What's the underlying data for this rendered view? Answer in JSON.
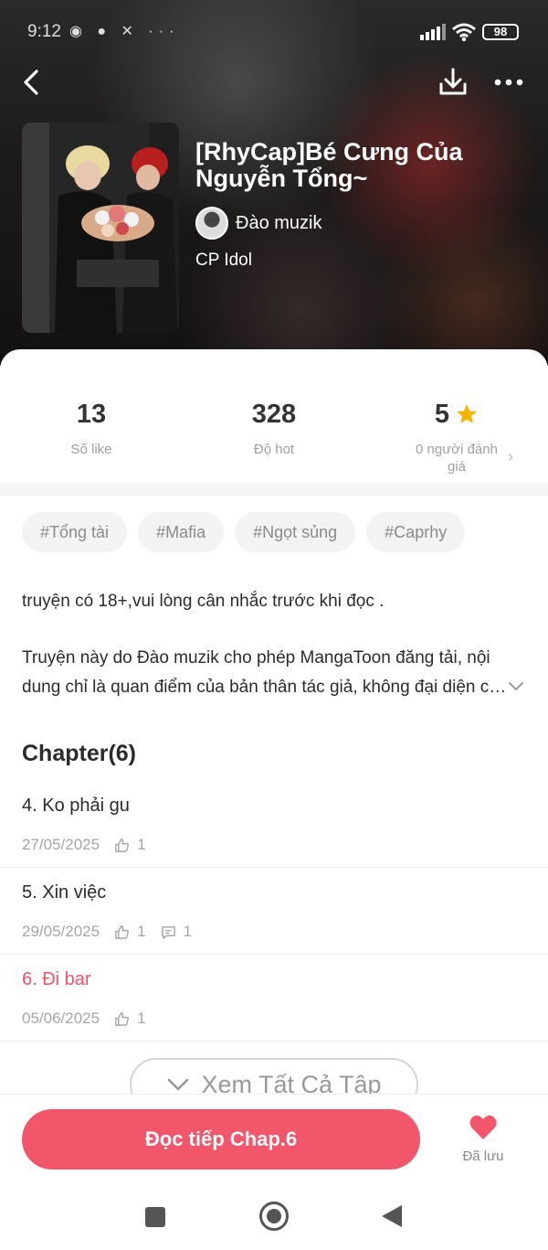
{
  "status_bar": {
    "time": "9:12",
    "notif_icons": "◉ ● ✕  ···",
    "battery": "98"
  },
  "comic": {
    "title": "[RhyCap]Bé Cưng Của Nguyễn Tổng~",
    "author": "Đào muzik",
    "genre": "CP Idol"
  },
  "stats": {
    "likes": {
      "value": "13",
      "label": "Số like"
    },
    "hot": {
      "value": "328",
      "label": "Độ hot"
    },
    "rating": {
      "value": "5",
      "label": "0 người đánh giá"
    }
  },
  "tags": [
    "#Tổng tài",
    "#Mafia",
    "#Ngọt sủng",
    "#Caprhy"
  ],
  "description": {
    "warning": "truyện có 18+,vui lòng cân nhắc trước khi đọc .",
    "notice": "Truyện này do Đào muzik cho phép MangaToon đăng tải, nội dung chỉ là quan điểm của bản thân tác giả, không đại diện cho quan điểm của MangaToon."
  },
  "chapters_header": "Chapter(6)",
  "chapters": [
    {
      "title": "4. Ko phải gu",
      "date": "27/05/2025",
      "likes": "1",
      "comments": ""
    },
    {
      "title": "5. Xin việc",
      "date": "29/05/2025",
      "likes": "1",
      "comments": "1"
    },
    {
      "title": "6. Đi bar",
      "date": "05/06/2025",
      "likes": "1",
      "comments": ""
    }
  ],
  "see_all_label": "Xem Tất Cả Tập",
  "read_button": "Đọc tiếp Chap.6",
  "saved_label": "Đã lưu",
  "colors": {
    "accent": "#f2566b",
    "current_chapter": "#f0566a",
    "star": "#f5b400"
  }
}
